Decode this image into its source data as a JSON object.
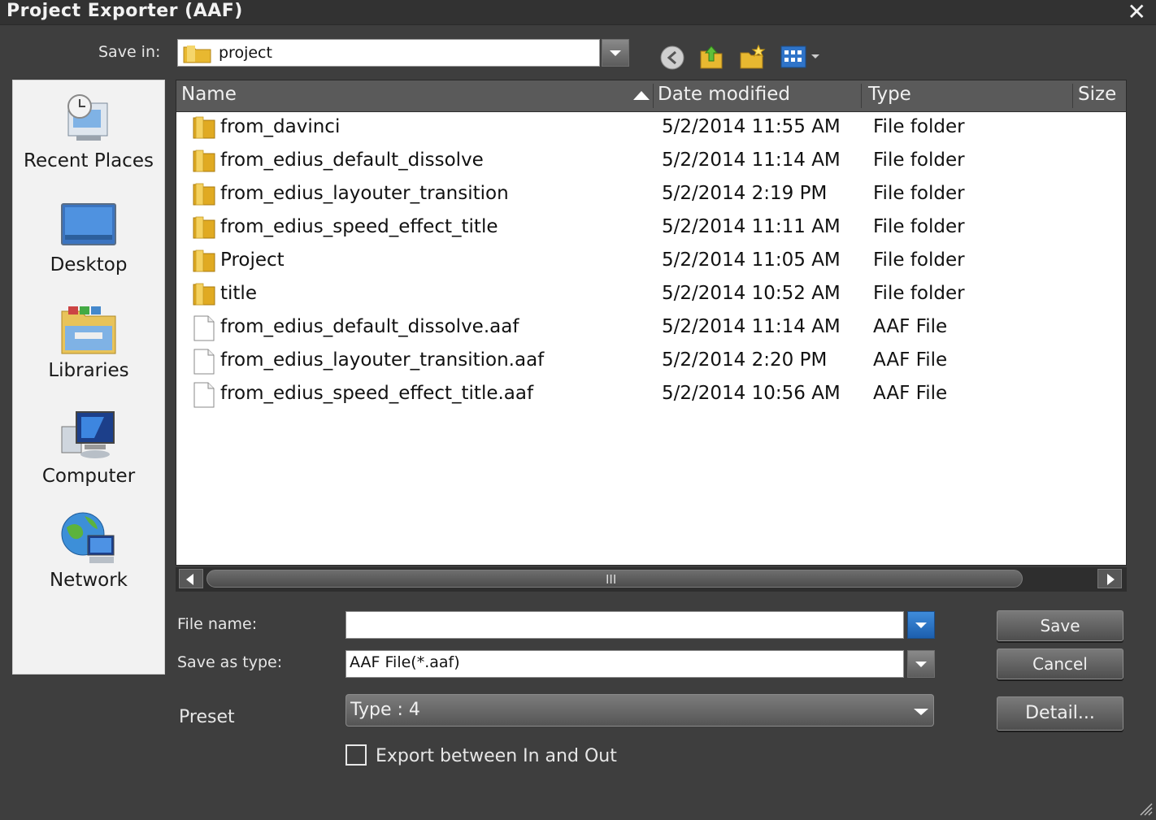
{
  "window": {
    "title": "Project Exporter (AAF)",
    "close_label": "✕"
  },
  "save_in": {
    "label": "Save in:",
    "value": "project"
  },
  "toolbar": {
    "icons": [
      "back-icon",
      "up-folder-icon",
      "new-folder-icon",
      "view-menu-icon"
    ]
  },
  "places": [
    {
      "label": "Recent Places",
      "icon": "recent-places-icon"
    },
    {
      "label": "Desktop",
      "icon": "desktop-icon"
    },
    {
      "label": "Libraries",
      "icon": "libraries-icon"
    },
    {
      "label": "Computer",
      "icon": "computer-icon"
    },
    {
      "label": "Network",
      "icon": "network-icon"
    }
  ],
  "columns": {
    "name": "Name",
    "date": "Date modified",
    "type": "Type",
    "size": "Size"
  },
  "files": [
    {
      "name": "from_davinci",
      "date": "5/2/2014 11:55 AM",
      "type": "File folder",
      "kind": "folder"
    },
    {
      "name": "from_edius_default_dissolve",
      "date": "5/2/2014 11:14 AM",
      "type": "File folder",
      "kind": "folder"
    },
    {
      "name": "from_edius_layouter_transition",
      "date": "5/2/2014 2:19 PM",
      "type": "File folder",
      "kind": "folder"
    },
    {
      "name": "from_edius_speed_effect_title",
      "date": "5/2/2014 11:11 AM",
      "type": "File folder",
      "kind": "folder"
    },
    {
      "name": "Project",
      "date": "5/2/2014 11:05 AM",
      "type": "File folder",
      "kind": "folder"
    },
    {
      "name": "title",
      "date": "5/2/2014 10:52 AM",
      "type": "File folder",
      "kind": "folder"
    },
    {
      "name": "from_edius_default_dissolve.aaf",
      "date": "5/2/2014 11:14 AM",
      "type": "AAF File",
      "kind": "file"
    },
    {
      "name": "from_edius_layouter_transition.aaf",
      "date": "5/2/2014 2:20 PM",
      "type": "AAF File",
      "kind": "file"
    },
    {
      "name": "from_edius_speed_effect_title.aaf",
      "date": "5/2/2014 10:56 AM",
      "type": "AAF File",
      "kind": "file"
    }
  ],
  "scrollbar": {
    "grip": "III"
  },
  "file_name": {
    "label": "File name:",
    "value": ""
  },
  "save_as_type": {
    "label": "Save as type:",
    "value": "AAF File(*.aaf)"
  },
  "preset": {
    "label": "Preset",
    "value": "Type : 4"
  },
  "export_between": {
    "label": "Export between In and Out",
    "checked": false
  },
  "buttons": {
    "save": "Save",
    "cancel": "Cancel",
    "detail": "Detail..."
  }
}
